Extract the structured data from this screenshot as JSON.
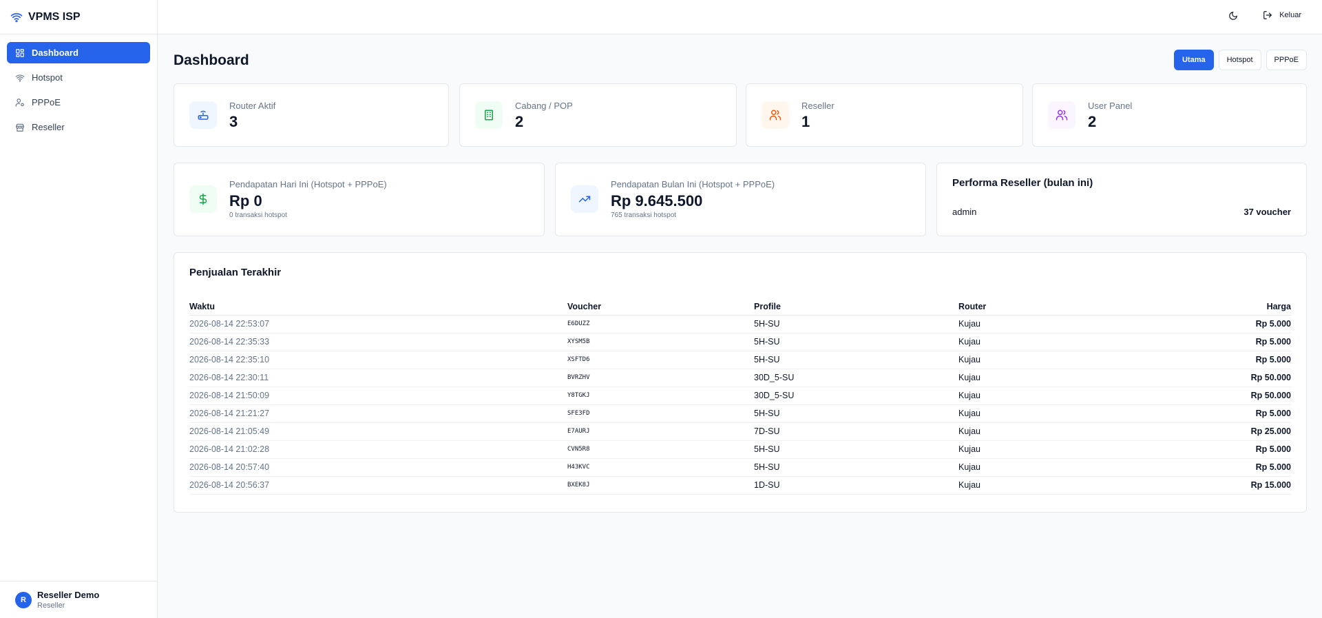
{
  "brand": {
    "name": "VPMS ISP"
  },
  "sidebar": {
    "items": [
      {
        "label": "Dashboard",
        "icon": "dashboard-icon",
        "active": true
      },
      {
        "label": "Hotspot",
        "icon": "wifi-icon"
      },
      {
        "label": "PPPoE",
        "icon": "user-cog-icon"
      },
      {
        "label": "Reseller",
        "icon": "store-icon"
      }
    ],
    "user": {
      "initial": "R",
      "name": "Reseller Demo",
      "role": "Reseller"
    }
  },
  "topbar": {
    "logout_label": "Keluar"
  },
  "page": {
    "title": "Dashboard",
    "tabs": [
      "Utama",
      "Hotspot",
      "PPPoE"
    ],
    "active_tab": "Utama"
  },
  "stats": [
    {
      "label": "Router Aktif",
      "value": "3",
      "icon": "router-icon",
      "color": "#2563eb"
    },
    {
      "label": "Cabang / POP",
      "value": "2",
      "icon": "building-icon",
      "color": "#16a34a"
    },
    {
      "label": "Reseller",
      "value": "1",
      "icon": "users-icon",
      "color": "#ea580c"
    },
    {
      "label": "User Panel",
      "value": "2",
      "icon": "users-icon",
      "color": "#9333ea"
    }
  ],
  "revenue": [
    {
      "label": "Pendapatan Hari Ini (Hotspot + PPPoE)",
      "value": "Rp 0",
      "sub": "0 transaksi hotspot",
      "icon": "dollar-icon",
      "color": "#16a34a"
    },
    {
      "label": "Pendapatan Bulan Ini (Hotspot + PPPoE)",
      "value": "Rp 9.645.500",
      "sub": "765 transaksi hotspot",
      "icon": "trending-up-icon",
      "color": "#2563eb"
    }
  ],
  "performance": {
    "title": "Performa Reseller (bulan ini)",
    "rows": [
      {
        "name": "admin",
        "count": "37 voucher"
      }
    ]
  },
  "sales": {
    "title": "Penjualan Terakhir",
    "columns": [
      "Waktu",
      "Voucher",
      "Profile",
      "Router",
      "Harga"
    ],
    "rows": [
      [
        "2026-08-14 22:53:07",
        "E6DUZZ",
        "5H-SU",
        "Kujau",
        "Rp 5.000"
      ],
      [
        "2026-08-14 22:35:33",
        "XYSM5B",
        "5H-SU",
        "Kujau",
        "Rp 5.000"
      ],
      [
        "2026-08-14 22:35:10",
        "XSFTD6",
        "5H-SU",
        "Kujau",
        "Rp 5.000"
      ],
      [
        "2026-08-14 22:30:11",
        "BVRZHV",
        "30D_5-SU",
        "Kujau",
        "Rp 50.000"
      ],
      [
        "2026-08-14 21:50:09",
        "Y8TGKJ",
        "30D_5-SU",
        "Kujau",
        "Rp 50.000"
      ],
      [
        "2026-08-14 21:21:27",
        "SFE3FD",
        "5H-SU",
        "Kujau",
        "Rp 5.000"
      ],
      [
        "2026-08-14 21:05:49",
        "E7AURJ",
        "7D-SU",
        "Kujau",
        "Rp 25.000"
      ],
      [
        "2026-08-14 21:02:28",
        "CVN5R8",
        "5H-SU",
        "Kujau",
        "Rp 5.000"
      ],
      [
        "2026-08-14 20:57:40",
        "H43KVC",
        "5H-SU",
        "Kujau",
        "Rp 5.000"
      ],
      [
        "2026-08-14 20:56:37",
        "BXEK8J",
        "1D-SU",
        "Kujau",
        "Rp 15.000"
      ]
    ]
  }
}
